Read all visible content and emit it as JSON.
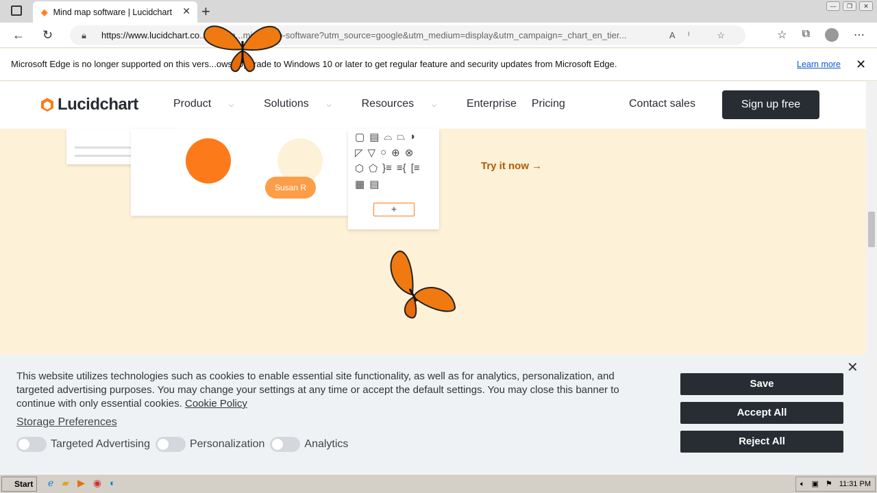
{
  "browser": {
    "tab_title": "Mind map software | Lucidchart",
    "tab_close": "✕",
    "new_tab": "+",
    "url_host": "https://www.lucidchart.co",
    "url_rest": "...ges/lan...mind-map-software?utm_source=google&utm_medium=display&utm_campaign=_chart_en_tier...",
    "tools": "A⁾ ☆",
    "window_controls": [
      "—",
      "❐",
      "✕"
    ]
  },
  "infobar": {
    "message": "Microsoft Edge is no longer supported on this vers...ows. Upgrade to Windows 10 or later to get regular feature and security updates from Microsoft Edge.",
    "link": "Learn more",
    "close": "✕"
  },
  "site": {
    "logo": "Lucidchart",
    "menu": {
      "product": "Product",
      "solutions": "Solutions",
      "resources": "Resources",
      "enterprise": "Enterprise",
      "pricing": "Pricing"
    },
    "contact": "Contact sales",
    "signup": "Sign up free"
  },
  "hero": {
    "avatar_label": "Susan R",
    "shapes": [
      [
        "▢",
        "▤",
        "⌓",
        "⏢",
        "◗"
      ],
      [
        "◸",
        "▽",
        "○",
        "⊕",
        "⊗"
      ],
      [
        "⬡",
        "⬠",
        "}≡",
        "≡{",
        "[≡"
      ],
      [
        "▦",
        "▤"
      ]
    ],
    "plus": "+",
    "try_link": "Try it now →"
  },
  "cookie": {
    "text": "This website utilizes technologies such as cookies to enable essential site functionality, as well as for analytics, personalization, and targeted advertising purposes. You may change your settings at any time or accept the default settings. You may close this banner to continue with only essential cookies.",
    "policy_link": "Cookie Policy",
    "storage_prefs": "Storage Preferences",
    "toggles": [
      "Targeted Advertising",
      "Personalization",
      "Analytics"
    ],
    "save": "Save",
    "accept": "Accept All",
    "reject": "Reject All",
    "close": "✕"
  },
  "taskbar": {
    "start": "Start",
    "time": "11:31 PM"
  },
  "colors": {
    "accent": "#fc7a1a",
    "dark": "#282c33",
    "hero_bg": "#fdf1d8"
  }
}
